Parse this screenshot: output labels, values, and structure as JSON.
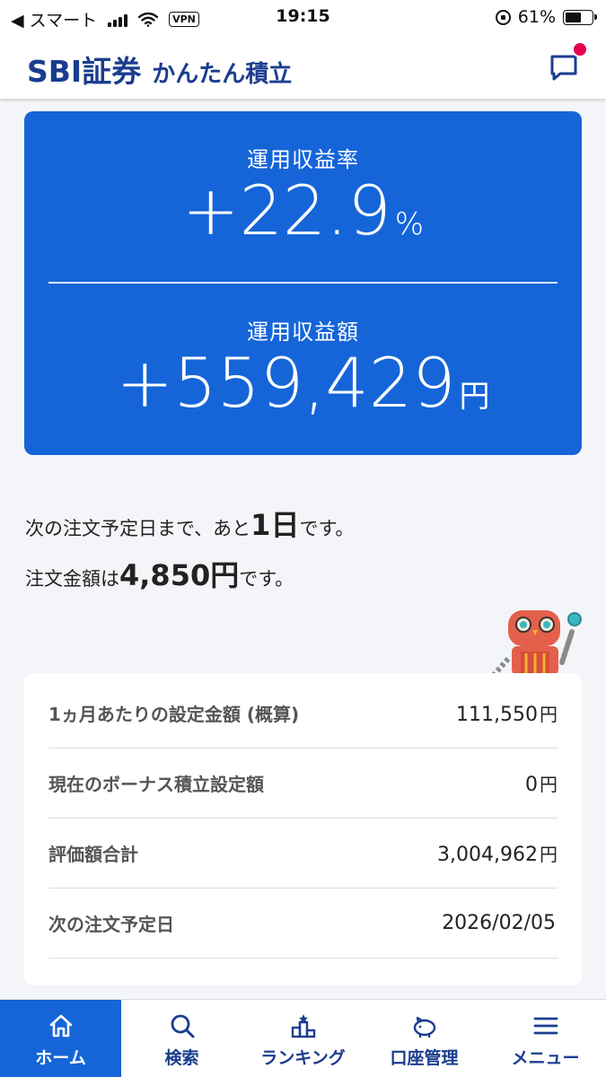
{
  "status_bar": {
    "back_label": "◀ スマート",
    "vpn": "VPN",
    "time": "19:15",
    "battery": "61%",
    "battery_level": 0.61
  },
  "header": {
    "brand": "SBI証券",
    "product": "かんたん積立",
    "message_icon": "chat-bubble-icon",
    "notification_color": "#e5004f"
  },
  "hero": {
    "rate_label": "運用収益率",
    "rate_value": "+22.9",
    "rate_unit": "%",
    "amount_label": "運用収益額",
    "amount_value": "+559,429",
    "amount_unit": "円",
    "bg_color": "#1565d8"
  },
  "order": {
    "next_prefix": "次の注文予定日まで、あと",
    "next_days": "1日",
    "next_suffix": "です。",
    "amount_prefix": "注文金額は",
    "amount": "4,850円",
    "amount_suffix": "です。"
  },
  "summary": {
    "rows": [
      {
        "label": "1ヵ月あたりの設定金額 (概算)",
        "value": "111,550",
        "unit": "円"
      },
      {
        "label": "現在のボーナス積立設定額",
        "value": "0",
        "unit": "円"
      },
      {
        "label": "評価額合計",
        "value": "3,004,962",
        "unit": "円"
      },
      {
        "label": "次の注文予定日",
        "value": "2026/02/05",
        "unit": ""
      }
    ]
  },
  "nav": {
    "items": [
      {
        "label": "ホーム",
        "icon": "home-icon",
        "active": true
      },
      {
        "label": "検索",
        "icon": "search-icon",
        "active": false
      },
      {
        "label": "ランキング",
        "icon": "podium-icon",
        "active": false
      },
      {
        "label": "口座管理",
        "icon": "piggy-bank-icon",
        "active": false
      },
      {
        "label": "メニュー",
        "icon": "menu-icon",
        "active": false
      }
    ]
  },
  "colors": {
    "brand_navy": "#1b3d8f",
    "accent_blue": "#1565d8",
    "background": "#f4f5f8"
  }
}
